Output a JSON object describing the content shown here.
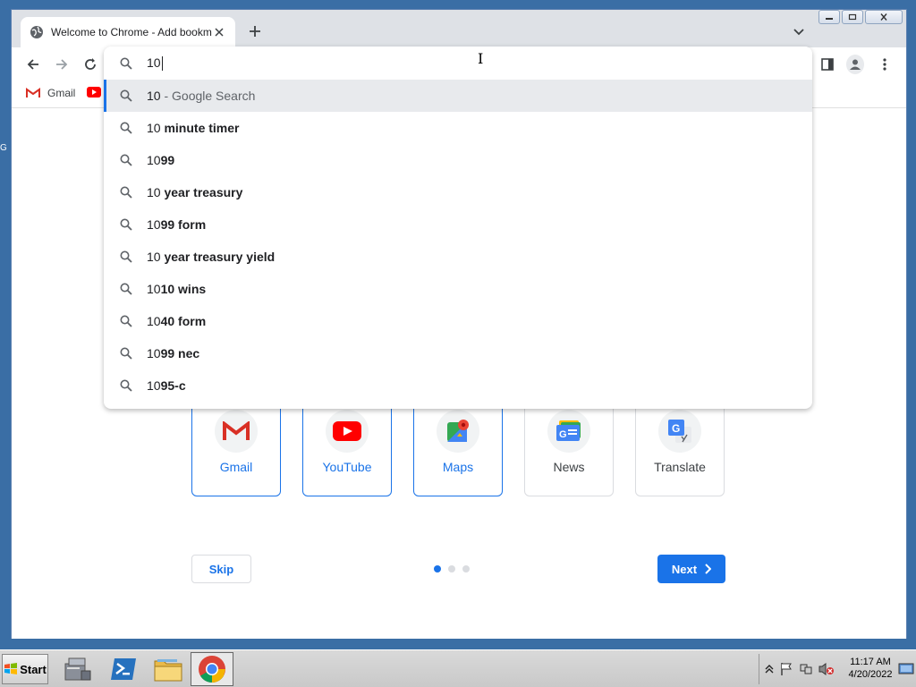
{
  "desktop": {
    "fragment": "G"
  },
  "browser": {
    "tab": {
      "title": "Welcome to Chrome - Add bookmarks"
    },
    "bookmarks": [
      {
        "label": "Gmail",
        "icon": "gmail-icon"
      },
      {
        "label": "",
        "icon": "youtube-icon"
      }
    ],
    "omnibox": {
      "typed": "10",
      "suggestions": [
        {
          "prefix": "10",
          "rest": "",
          "suffix": " - Google Search",
          "highlight": true
        },
        {
          "prefix": "10",
          "rest": " minute timer",
          "suffix": ""
        },
        {
          "prefix": "10",
          "rest": "99",
          "suffix": ""
        },
        {
          "prefix": "10",
          "rest": " year treasury",
          "suffix": ""
        },
        {
          "prefix": "10",
          "rest": "99 form",
          "suffix": ""
        },
        {
          "prefix": "10",
          "rest": " year treasury yield",
          "suffix": ""
        },
        {
          "prefix": "10",
          "rest": "10 wins",
          "suffix": ""
        },
        {
          "prefix": "10",
          "rest": "40 form",
          "suffix": ""
        },
        {
          "prefix": "10",
          "rest": "99 nec",
          "suffix": ""
        },
        {
          "prefix": "10",
          "rest": "95-c",
          "suffix": ""
        }
      ]
    }
  },
  "page": {
    "apps": [
      {
        "label": "Gmail",
        "icon": "gmail-icon",
        "selected": true
      },
      {
        "label": "YouTube",
        "icon": "youtube-icon",
        "selected": true
      },
      {
        "label": "Maps",
        "icon": "maps-icon",
        "selected": true
      },
      {
        "label": "News",
        "icon": "news-icon",
        "selected": false
      },
      {
        "label": "Translate",
        "icon": "translate-icon",
        "selected": false
      }
    ],
    "skip_label": "Skip",
    "next_label": "Next",
    "pagination": {
      "current": 1,
      "total": 3
    }
  },
  "taskbar": {
    "start_label": "Start",
    "time": "11:17 AM",
    "date": "4/20/2022"
  },
  "colors": {
    "accent": "#1a73e8",
    "tabstrip": "#dee1e6",
    "desktop": "#3a6ea5"
  }
}
